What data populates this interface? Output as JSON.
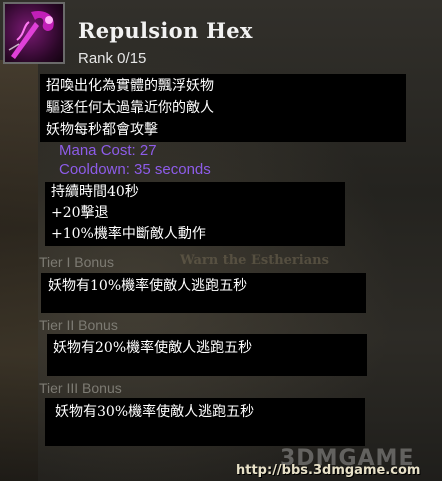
{
  "skill": {
    "name": "Repulsion Hex",
    "rank": "Rank 0/15",
    "icon": "repulsion-hex-icon",
    "description": [
      "招喚出化為實體的飄浮妖物",
      "驅逐任何太過靠近你的敵人",
      "妖物每秒都會攻擊"
    ],
    "mana_cost": "Mana Cost: 27",
    "cooldown": "Cooldown: 35 seconds",
    "stats": [
      "持續時間40秒",
      "+20擊退",
      "+10%機率中斷敵人動作"
    ]
  },
  "tiers": [
    {
      "label": "Tier I Bonus",
      "text": "妖物有10%機率使敵人逃跑五秒"
    },
    {
      "label": "Tier II Bonus",
      "text": "妖物有20%機率使敵人逃跑五秒"
    },
    {
      "label": "Tier III Bonus",
      "text": "妖物有30%機率使敵人逃跑五秒"
    }
  ],
  "background_text": "Warn the Estherians",
  "watermark": {
    "logo": "3DMGAME",
    "url": "http://bbs.3dmgame.com"
  },
  "colors": {
    "mana_text": "#8d5ce8",
    "tier_label": "#7d7b73",
    "title": "#f2f2f2"
  }
}
